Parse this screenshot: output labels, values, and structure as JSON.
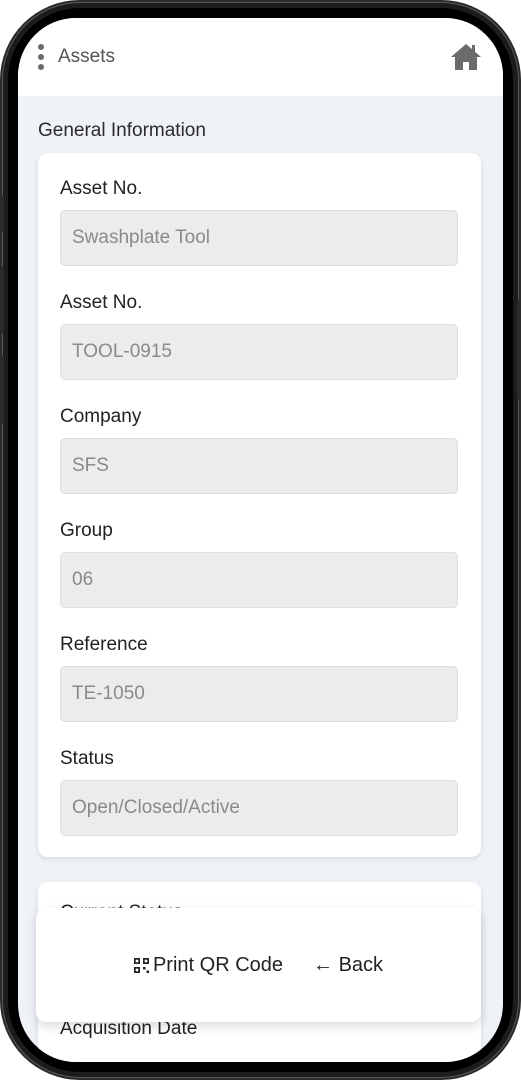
{
  "header": {
    "title": "Assets"
  },
  "section": {
    "title": "General Information"
  },
  "fields": [
    {
      "label": "Asset No.",
      "value": "Swashplate Tool"
    },
    {
      "label": "Asset No.",
      "value": "TOOL-0915"
    },
    {
      "label": "Company",
      "value": "SFS"
    },
    {
      "label": "Group",
      "value": "06"
    },
    {
      "label": "Reference",
      "value": "TE-1050"
    },
    {
      "label": "Status",
      "value": "Open/Closed/Active"
    }
  ],
  "next_section": {
    "partial_label": "Current Status"
  },
  "acquisition": {
    "label": "Acquisition Date"
  },
  "actions": {
    "print_label": "Print QR Code",
    "back_label": "← Back"
  },
  "colors": {
    "background": "#eff2f7",
    "input_bg": "#ececec",
    "icon": "#6b6b6b"
  }
}
